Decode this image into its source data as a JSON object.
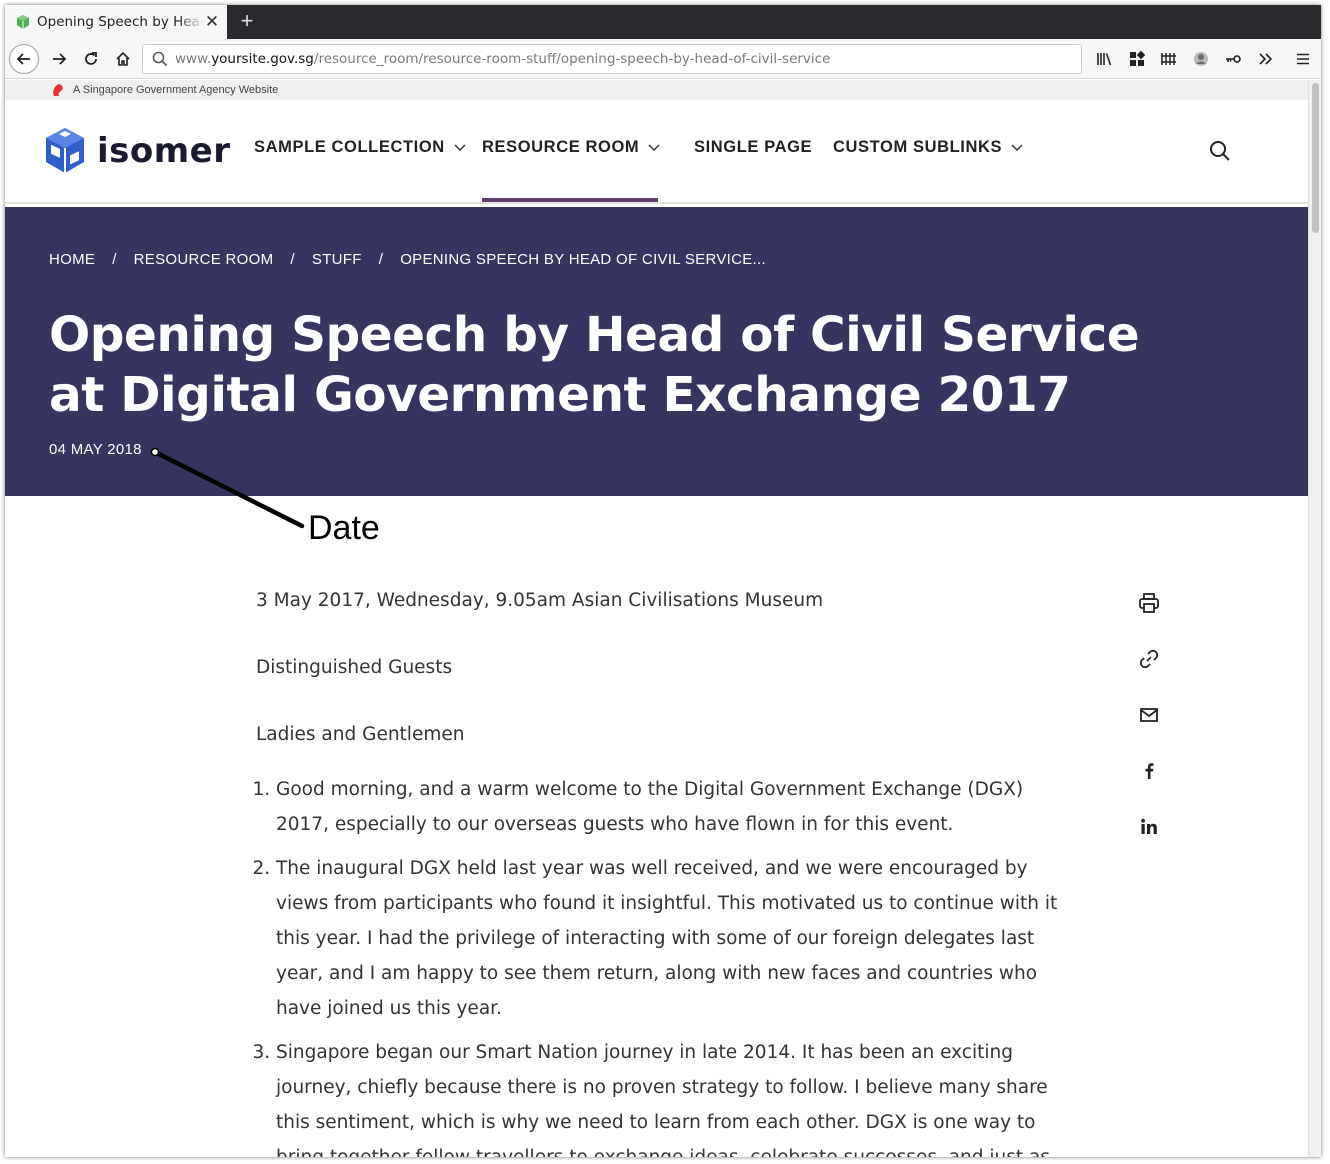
{
  "browser": {
    "tab_title": "Opening Speech by Head of Civil Service",
    "url_prefix": "www.",
    "url_host": "yoursite.gov.sg",
    "url_path": "/resource_room/resource-room-stuff/opening-speech-by-head-of-civil-service"
  },
  "govbar": {
    "text": "A Singapore Government Agency Website"
  },
  "header": {
    "logo_text": "isomer",
    "menu": [
      {
        "label": "SAMPLE COLLECTION",
        "has_dropdown": true
      },
      {
        "label": "RESOURCE ROOM",
        "has_dropdown": true,
        "active": true
      },
      {
        "label": "SINGLE PAGE",
        "has_dropdown": false
      },
      {
        "label": "CUSTOM SUBLINKS",
        "has_dropdown": true
      }
    ]
  },
  "hero": {
    "breadcrumb": [
      "HOME",
      "RESOURCE ROOM",
      "STUFF",
      "OPENING SPEECH BY HEAD OF CIVIL SERVICE..."
    ],
    "breadcrumb_separator": "/",
    "title": "Opening Speech by Head of Civil Service at Digital Government Exchange 2017",
    "date": "04 MAY 2018"
  },
  "annotation": {
    "label": "Date"
  },
  "article": {
    "intro": [
      "3 May 2017, Wednesday, 9.05am Asian Civilisations Museum",
      "Distinguished Guests",
      "Ladies and Gentlemen"
    ],
    "points": [
      "Good morning, and a warm welcome to the Digital Government Exchange (DGX) 2017, especially to our overseas guests who have flown in for this event.",
      "The inaugural DGX held last year was well received, and we were encouraged by views from participants who found it insightful. This motivated us to continue with it this year. I had the privilege of interacting with some of our foreign delegates last year, and I am happy to see them return, along with new faces and countries who have joined us this year.",
      "Singapore began our Smart Nation journey in late 2014. It has been an exciting journey, chiefly because there is no proven strategy to follow. I believe many share this sentiment, which is why we need to learn from each other. DGX is one way to bring together fellow travellers to exchange ideas, celebrate successes, and just as importantly"
    ]
  },
  "share_icons": [
    "print-icon",
    "link-icon",
    "email-icon",
    "facebook-icon",
    "linkedin-icon"
  ],
  "colors": {
    "hero_bg": "#363560",
    "active_menu_underline": "#5f3d6e",
    "logo_blue": "#2f5fc9"
  }
}
